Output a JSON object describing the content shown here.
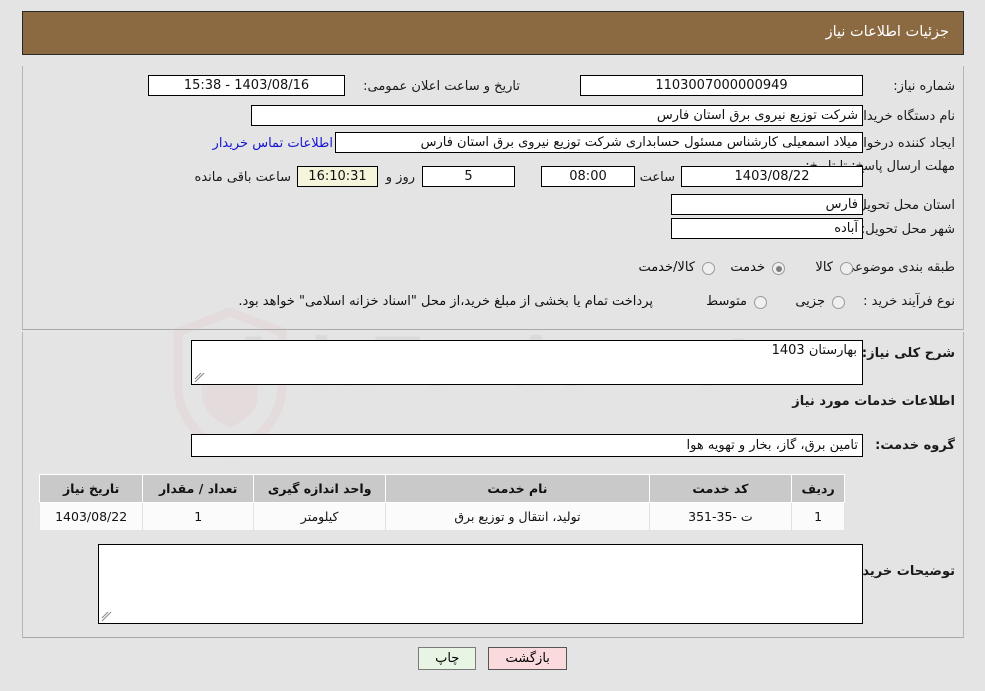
{
  "header": {
    "title": "جزئیات اطلاعات نیاز"
  },
  "colors": {
    "header_bg": "#8b6a42",
    "page_bg": "#e4e4e4",
    "link": "#1414d2",
    "timer_bg": "#f5f5dc",
    "back_btn_bg": "#fadadd",
    "print_btn_bg": "#e8f5e4",
    "table_header_bg": "#c9c9c9"
  },
  "watermark": {
    "text": "AriaTender.net"
  },
  "form": {
    "need_number_label": "شماره نیاز:",
    "need_number_value": "1103007000000949",
    "announce_datetime_label": "تاریخ و ساعت اعلان عمومی:",
    "announce_datetime_value": "1403/08/16 - 15:38",
    "buyer_org_label": "نام دستگاه خریدار:",
    "buyer_org_value": "شرکت توزیع نیروی برق استان فارس",
    "requester_label": "ایجاد کننده درخواست:",
    "requester_value": "میلاد اسمعیلی کارشناس مسئول حسابداری شرکت توزیع نیروی برق استان فارس",
    "buyer_contact_link": "اطلاعات تماس خریدار",
    "deadline_label": "مهلت ارسال پاسخ: تا تاریخ:",
    "deadline_date": "1403/08/22",
    "deadline_hour_label": "ساعت",
    "deadline_hour_value": "08:00",
    "remaining_days": "5",
    "remaining_days_label": "روز و",
    "remaining_time": "16:10:31",
    "remaining_time_label": "ساعت باقی مانده",
    "province_label": "استان محل تحویل:",
    "province_value": "فارس",
    "city_label": "شهر محل تحویل:",
    "city_value": "آباده",
    "category_label": "طبقه بندی موضوعی:",
    "category_options": [
      {
        "label": "کالا",
        "selected": false
      },
      {
        "label": "خدمت",
        "selected": true
      },
      {
        "label": "کالا/خدمت",
        "selected": false
      }
    ],
    "process_label": "نوع فرآیند خرید :",
    "process_options": [
      {
        "label": "جزیی",
        "selected": false
      },
      {
        "label": "متوسط",
        "selected": false
      }
    ],
    "payment_note": "پرداخت تمام یا بخشی از مبلغ خرید،از محل \"اسناد خزانه اسلامی\" خواهد بود."
  },
  "details": {
    "general_desc_label": "شرح کلی نیاز:",
    "general_desc_value": "بهارستان 1403",
    "services_section_title": "اطلاعات خدمات مورد نیاز",
    "service_group_label": "گروه خدمت:",
    "service_group_value": "تامین برق، گاز، بخار و تهویه هوا",
    "buyer_notes_label": "توضیحات خریدار:",
    "buyer_notes_value": ""
  },
  "table": {
    "columns": [
      "ردیف",
      "کد خدمت",
      "نام خدمت",
      "واحد اندازه گیری",
      "تعداد / مقدار",
      "تاریخ نیاز"
    ],
    "rows": [
      {
        "row": "1",
        "code": "ت -35-351",
        "name": "تولید، انتقال و توزیع برق",
        "unit": "کیلومتر",
        "qty": "1",
        "date": "1403/08/22"
      }
    ]
  },
  "buttons": {
    "print": "چاپ",
    "back": "بازگشت"
  }
}
